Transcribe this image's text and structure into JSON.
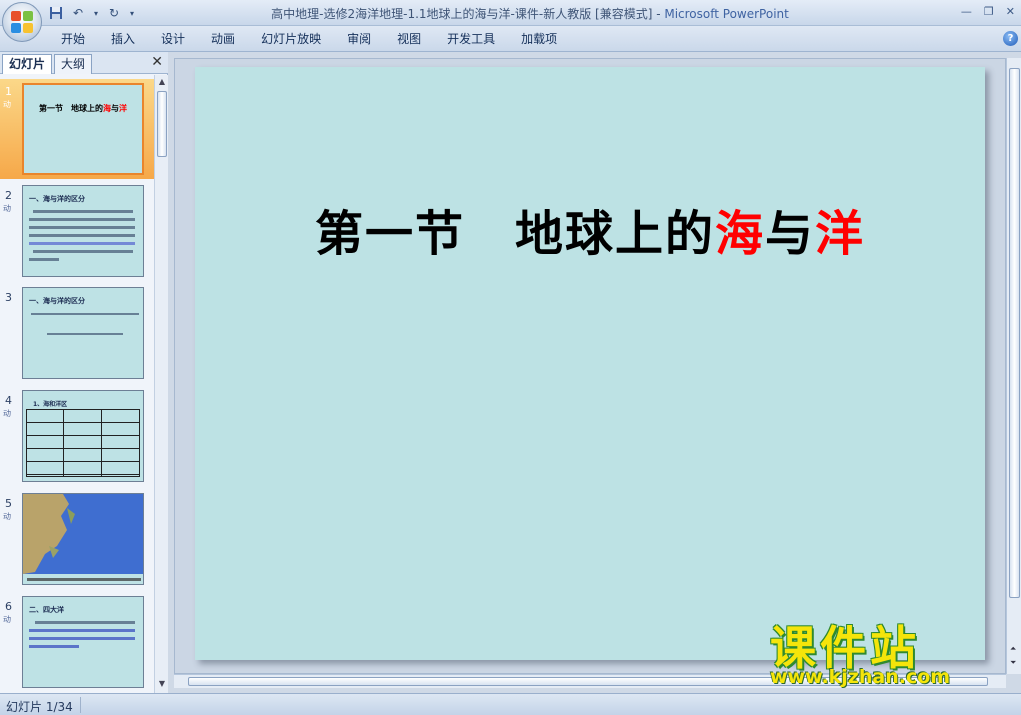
{
  "window": {
    "title_doc": "高中地理-选修2海洋地理-1.1地球上的海与洋-课件-新人教版 [兼容模式] - ",
    "title_app": "Microsoft PowerPoint"
  },
  "ribbon": {
    "tabs": [
      "开始",
      "插入",
      "设计",
      "动画",
      "幻灯片放映",
      "审阅",
      "视图",
      "开发工具",
      "加载项"
    ],
    "help_label": "?"
  },
  "left_pane": {
    "tabs": [
      "幻灯片",
      "大纲"
    ],
    "close_label": "✕",
    "slides": [
      {
        "num": "1",
        "title_parts": [
          "第一节　地球上的",
          "海",
          "与",
          "洋"
        ]
      },
      {
        "num": "2",
        "heading": "一、海与洋的区分"
      },
      {
        "num": "3",
        "heading": "一、海与洋的区分"
      },
      {
        "num": "4",
        "heading": "1、海和洋区"
      },
      {
        "num": "5",
        "heading": ""
      },
      {
        "num": "6",
        "heading": "二、四大洋"
      }
    ],
    "anim_label": "动"
  },
  "slide": {
    "title_a": "第一节　地球上的",
    "title_b": "海",
    "title_c": "与",
    "title_d": "洋",
    "background": "#bde2e4"
  },
  "watermark": {
    "main": "课件站",
    "url": "www.kjzhan.com"
  },
  "status": {
    "slide_counter": "幻灯片 1/34"
  },
  "colors": {
    "accent_red": "#ff0000",
    "selection": "#f6a849",
    "watermark_yellow": "#f5e50a"
  }
}
